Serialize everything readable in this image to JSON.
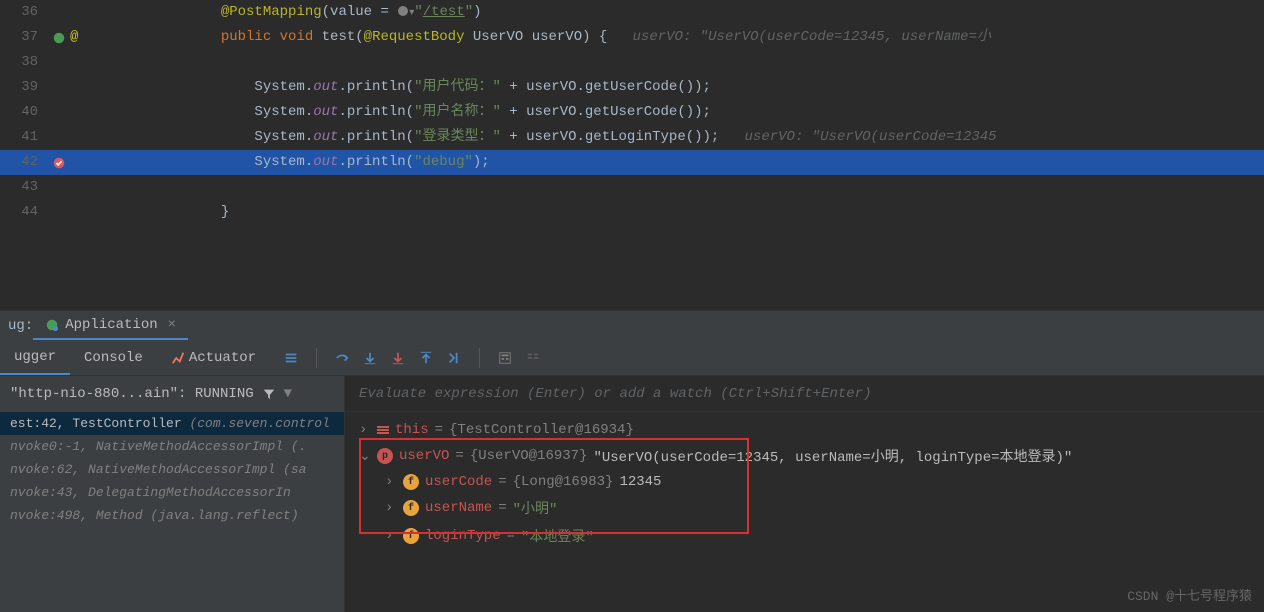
{
  "editor": {
    "lines": [
      {
        "num": "36",
        "indent": "            ",
        "tokens": [
          {
            "t": "@PostMapping",
            "c": "kw-annotation"
          },
          {
            "t": "(value = ",
            "c": ""
          },
          {
            "t": "\"",
            "c": "kw-string"
          },
          {
            "t": "/test",
            "c": "kw-url"
          },
          {
            "t": "\"",
            "c": "kw-string"
          },
          {
            "t": ")",
            "c": ""
          }
        ],
        "globe": true
      },
      {
        "num": "37",
        "indent": "            ",
        "tokens": [
          {
            "t": "public void ",
            "c": "kw-keyword"
          },
          {
            "t": "test(",
            "c": ""
          },
          {
            "t": "@RequestBody ",
            "c": "kw-annotation"
          },
          {
            "t": "UserVO userVO) {",
            "c": ""
          }
        ],
        "leaf": true,
        "at": true,
        "inlay": "userVO: \"UserVO(userCode=12345, userName=小"
      },
      {
        "num": "38",
        "indent": "",
        "tokens": []
      },
      {
        "num": "39",
        "indent": "                ",
        "tokens": [
          {
            "t": "System.",
            "c": ""
          },
          {
            "t": "out",
            "c": "kw-field"
          },
          {
            "t": ".println(",
            "c": ""
          },
          {
            "t": "\"用户代码：\"",
            "c": "kw-string"
          },
          {
            "t": " + userVO.getUserCode());",
            "c": ""
          }
        ]
      },
      {
        "num": "40",
        "indent": "                ",
        "tokens": [
          {
            "t": "System.",
            "c": ""
          },
          {
            "t": "out",
            "c": "kw-field"
          },
          {
            "t": ".println(",
            "c": ""
          },
          {
            "t": "\"用户名称：\"",
            "c": "kw-string"
          },
          {
            "t": " + userVO.getUserCode());",
            "c": ""
          }
        ]
      },
      {
        "num": "41",
        "indent": "                ",
        "tokens": [
          {
            "t": "System.",
            "c": ""
          },
          {
            "t": "out",
            "c": "kw-field"
          },
          {
            "t": ".println(",
            "c": ""
          },
          {
            "t": "\"登录类型：\"",
            "c": "kw-string"
          },
          {
            "t": " + userVO.getLoginType());",
            "c": ""
          }
        ],
        "inlay": "userVO: \"UserVO(userCode=12345"
      },
      {
        "num": "42",
        "indent": "                ",
        "tokens": [
          {
            "t": "System.",
            "c": ""
          },
          {
            "t": "out",
            "c": "kw-field"
          },
          {
            "t": ".println(",
            "c": ""
          },
          {
            "t": "\"debug\"",
            "c": "kw-string"
          },
          {
            "t": ");",
            "c": ""
          }
        ],
        "highlighted": true,
        "bp": true
      },
      {
        "num": "43",
        "indent": "",
        "tokens": []
      },
      {
        "num": "44",
        "indent": "            ",
        "tokens": [
          {
            "t": "}",
            "c": ""
          }
        ]
      }
    ]
  },
  "debug": {
    "panel_label": "ug:",
    "tab_name": "Application",
    "subtabs": {
      "debugger": "ugger",
      "console": "Console",
      "actuator": "Actuator"
    },
    "thread_label": "\"http-nio-880...ain\": RUNNING",
    "eval_placeholder": "Evaluate expression (Enter) or add a watch (Ctrl+Shift+Enter)",
    "frames": [
      {
        "text": "est:42, TestController ",
        "suffix": "(com.seven.control",
        "selected": true
      },
      {
        "text": "nvoke0:-1, NativeMethodAccessorImpl ",
        "suffix": "(.",
        "gray": true
      },
      {
        "text": "nvoke:62, NativeMethodAccessorImpl ",
        "suffix": "(sa",
        "gray": true
      },
      {
        "text": "nvoke:43, DelegatingMethodAccessorIn",
        "suffix": "",
        "gray": true
      },
      {
        "text": "nvoke:498, Method ",
        "suffix": "(java.lang.reflect)",
        "gray": true
      }
    ],
    "variables": {
      "this_name": "this",
      "this_val": "{TestController@16934}",
      "uservo_name": "userVO",
      "uservo_type": "{UserVO@16937}",
      "uservo_string": "\"UserVO(userCode=12345, userName=小明, loginType=本地登录)\"",
      "fields": [
        {
          "name": "userCode",
          "type": "{Long@16983}",
          "value": "12345"
        },
        {
          "name": "userName",
          "value": "\"小明\""
        },
        {
          "name": "loginType",
          "value": "\"本地登录\""
        }
      ]
    }
  },
  "watermark": "CSDN @十七号程序猿"
}
